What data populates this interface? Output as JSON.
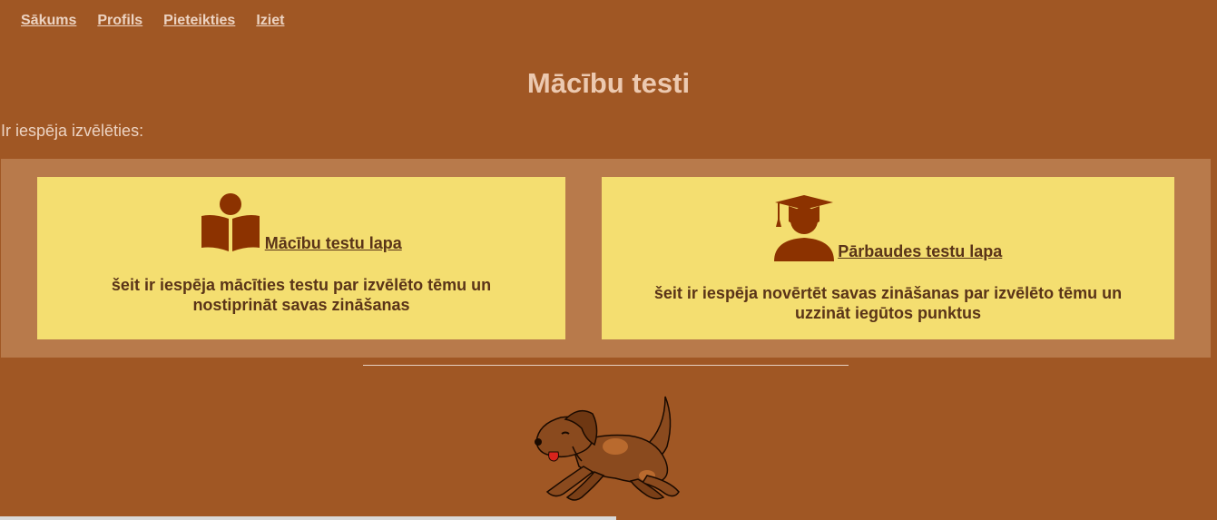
{
  "nav": {
    "items": [
      {
        "label": "Sākums"
      },
      {
        "label": "Profils"
      },
      {
        "label": "Pieteikties"
      },
      {
        "label": "Iziet"
      }
    ]
  },
  "page": {
    "title": "Mācību testi",
    "intro": "Ir iespēja izvēlēties:"
  },
  "cards": [
    {
      "icon": "reading-book-icon",
      "link": "Mācību testu lapa",
      "description": "šeit ir iespēja mācīties testu par izvēlēto tēmu un nostiprināt savas zināšanas"
    },
    {
      "icon": "graduate-cap-icon",
      "link": "Pārbaudes testu lapa",
      "description": "šeit ir iespēja novērtēt savas zināšanas par izvēlēto tēmu un uzzināt iegūtos punktus"
    }
  ],
  "colors": {
    "background": "#a05724",
    "panel": "#b87a4b",
    "card": "#f4de70",
    "icon": "#8c3200",
    "text": "#5a3418"
  }
}
